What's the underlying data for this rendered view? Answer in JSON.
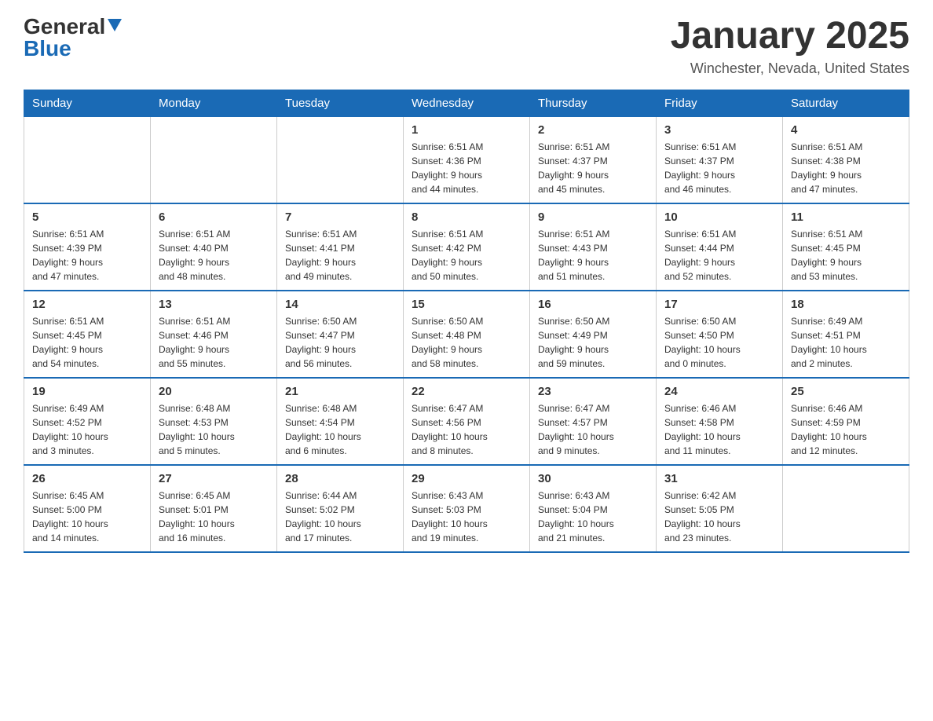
{
  "header": {
    "logo_general": "General",
    "logo_blue": "Blue",
    "title": "January 2025",
    "subtitle": "Winchester, Nevada, United States"
  },
  "days_of_week": [
    "Sunday",
    "Monday",
    "Tuesday",
    "Wednesday",
    "Thursday",
    "Friday",
    "Saturday"
  ],
  "weeks": [
    {
      "days": [
        {
          "number": "",
          "info": ""
        },
        {
          "number": "",
          "info": ""
        },
        {
          "number": "",
          "info": ""
        },
        {
          "number": "1",
          "info": "Sunrise: 6:51 AM\nSunset: 4:36 PM\nDaylight: 9 hours\nand 44 minutes."
        },
        {
          "number": "2",
          "info": "Sunrise: 6:51 AM\nSunset: 4:37 PM\nDaylight: 9 hours\nand 45 minutes."
        },
        {
          "number": "3",
          "info": "Sunrise: 6:51 AM\nSunset: 4:37 PM\nDaylight: 9 hours\nand 46 minutes."
        },
        {
          "number": "4",
          "info": "Sunrise: 6:51 AM\nSunset: 4:38 PM\nDaylight: 9 hours\nand 47 minutes."
        }
      ]
    },
    {
      "days": [
        {
          "number": "5",
          "info": "Sunrise: 6:51 AM\nSunset: 4:39 PM\nDaylight: 9 hours\nand 47 minutes."
        },
        {
          "number": "6",
          "info": "Sunrise: 6:51 AM\nSunset: 4:40 PM\nDaylight: 9 hours\nand 48 minutes."
        },
        {
          "number": "7",
          "info": "Sunrise: 6:51 AM\nSunset: 4:41 PM\nDaylight: 9 hours\nand 49 minutes."
        },
        {
          "number": "8",
          "info": "Sunrise: 6:51 AM\nSunset: 4:42 PM\nDaylight: 9 hours\nand 50 minutes."
        },
        {
          "number": "9",
          "info": "Sunrise: 6:51 AM\nSunset: 4:43 PM\nDaylight: 9 hours\nand 51 minutes."
        },
        {
          "number": "10",
          "info": "Sunrise: 6:51 AM\nSunset: 4:44 PM\nDaylight: 9 hours\nand 52 minutes."
        },
        {
          "number": "11",
          "info": "Sunrise: 6:51 AM\nSunset: 4:45 PM\nDaylight: 9 hours\nand 53 minutes."
        }
      ]
    },
    {
      "days": [
        {
          "number": "12",
          "info": "Sunrise: 6:51 AM\nSunset: 4:45 PM\nDaylight: 9 hours\nand 54 minutes."
        },
        {
          "number": "13",
          "info": "Sunrise: 6:51 AM\nSunset: 4:46 PM\nDaylight: 9 hours\nand 55 minutes."
        },
        {
          "number": "14",
          "info": "Sunrise: 6:50 AM\nSunset: 4:47 PM\nDaylight: 9 hours\nand 56 minutes."
        },
        {
          "number": "15",
          "info": "Sunrise: 6:50 AM\nSunset: 4:48 PM\nDaylight: 9 hours\nand 58 minutes."
        },
        {
          "number": "16",
          "info": "Sunrise: 6:50 AM\nSunset: 4:49 PM\nDaylight: 9 hours\nand 59 minutes."
        },
        {
          "number": "17",
          "info": "Sunrise: 6:50 AM\nSunset: 4:50 PM\nDaylight: 10 hours\nand 0 minutes."
        },
        {
          "number": "18",
          "info": "Sunrise: 6:49 AM\nSunset: 4:51 PM\nDaylight: 10 hours\nand 2 minutes."
        }
      ]
    },
    {
      "days": [
        {
          "number": "19",
          "info": "Sunrise: 6:49 AM\nSunset: 4:52 PM\nDaylight: 10 hours\nand 3 minutes."
        },
        {
          "number": "20",
          "info": "Sunrise: 6:48 AM\nSunset: 4:53 PM\nDaylight: 10 hours\nand 5 minutes."
        },
        {
          "number": "21",
          "info": "Sunrise: 6:48 AM\nSunset: 4:54 PM\nDaylight: 10 hours\nand 6 minutes."
        },
        {
          "number": "22",
          "info": "Sunrise: 6:47 AM\nSunset: 4:56 PM\nDaylight: 10 hours\nand 8 minutes."
        },
        {
          "number": "23",
          "info": "Sunrise: 6:47 AM\nSunset: 4:57 PM\nDaylight: 10 hours\nand 9 minutes."
        },
        {
          "number": "24",
          "info": "Sunrise: 6:46 AM\nSunset: 4:58 PM\nDaylight: 10 hours\nand 11 minutes."
        },
        {
          "number": "25",
          "info": "Sunrise: 6:46 AM\nSunset: 4:59 PM\nDaylight: 10 hours\nand 12 minutes."
        }
      ]
    },
    {
      "days": [
        {
          "number": "26",
          "info": "Sunrise: 6:45 AM\nSunset: 5:00 PM\nDaylight: 10 hours\nand 14 minutes."
        },
        {
          "number": "27",
          "info": "Sunrise: 6:45 AM\nSunset: 5:01 PM\nDaylight: 10 hours\nand 16 minutes."
        },
        {
          "number": "28",
          "info": "Sunrise: 6:44 AM\nSunset: 5:02 PM\nDaylight: 10 hours\nand 17 minutes."
        },
        {
          "number": "29",
          "info": "Sunrise: 6:43 AM\nSunset: 5:03 PM\nDaylight: 10 hours\nand 19 minutes."
        },
        {
          "number": "30",
          "info": "Sunrise: 6:43 AM\nSunset: 5:04 PM\nDaylight: 10 hours\nand 21 minutes."
        },
        {
          "number": "31",
          "info": "Sunrise: 6:42 AM\nSunset: 5:05 PM\nDaylight: 10 hours\nand 23 minutes."
        },
        {
          "number": "",
          "info": ""
        }
      ]
    }
  ]
}
